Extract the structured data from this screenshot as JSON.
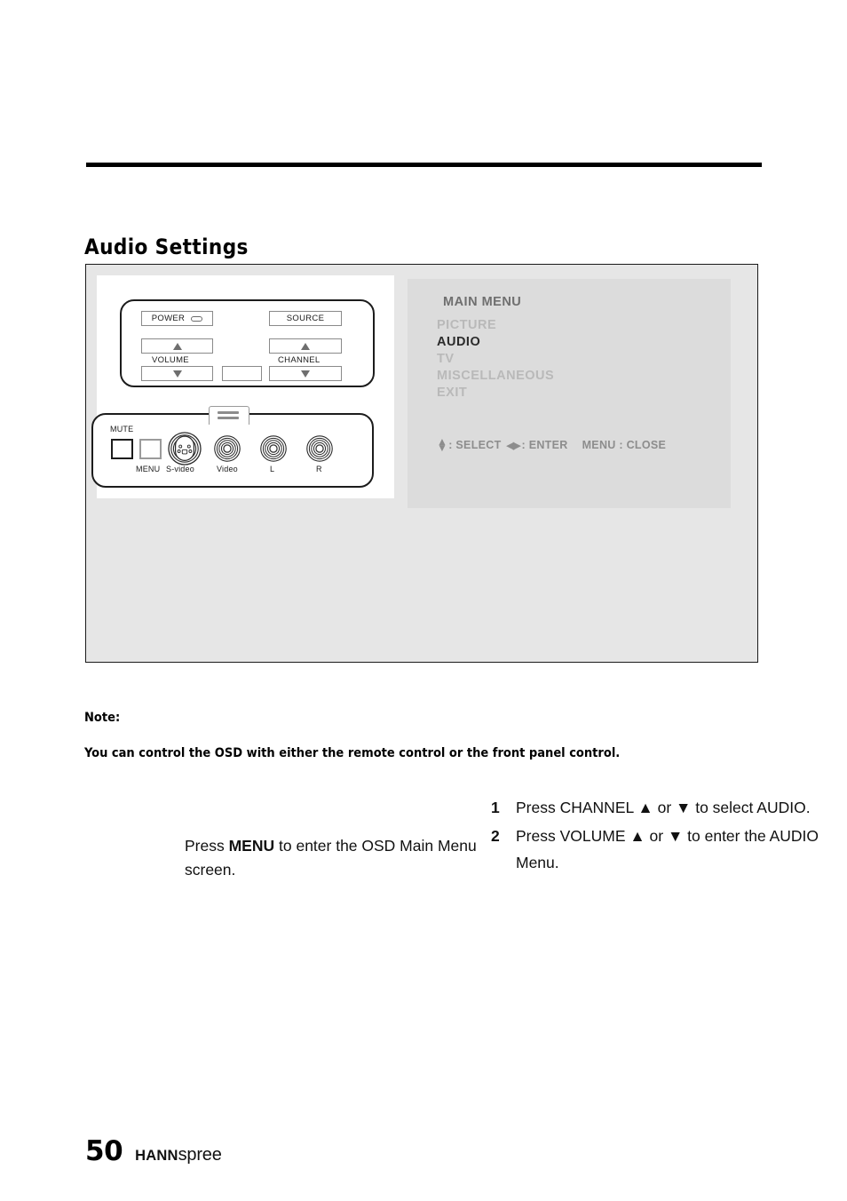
{
  "page": {
    "title": "Audio Settings",
    "number": "50",
    "brand_bold": "HANN",
    "brand_light": "spree"
  },
  "control_panel": {
    "upper": {
      "power_label": "POWER",
      "source_label": "SOURCE",
      "volume_label": "VOLUME",
      "channel_label": "CHANNEL",
      "up_glyph": "△",
      "down_glyph": "▽"
    },
    "lower": {
      "mute_label": "MUTE",
      "menu_label": "MENU",
      "svideo_label": "S-video",
      "video_label": "Video",
      "left_label": "L",
      "right_label": "R"
    }
  },
  "osd": {
    "title": "MAIN MENU",
    "items": [
      {
        "label": "PICTURE",
        "selected": false
      },
      {
        "label": "AUDIO",
        "selected": true
      },
      {
        "label": "TV",
        "selected": false
      },
      {
        "label": "MISCELLANEOUS",
        "selected": false
      },
      {
        "label": "EXIT",
        "selected": false
      }
    ],
    "hint": {
      "select_label": ": SELECT",
      "enter_label": ": ENTER",
      "close_label": "MENU : CLOSE",
      "up_glyph": "▲",
      "down_glyph": "▼",
      "left_glyph": "◀",
      "right_glyph": "▶"
    }
  },
  "instructions": {
    "left": {
      "before": "Press ",
      "bold": "MENU",
      "after": " to enter the OSD Main Menu screen."
    },
    "steps": [
      {
        "num": "1",
        "text": "Press CHANNEL ▲ or ▼ to select AUDIO."
      },
      {
        "num": "2",
        "text": "Press VOLUME ▲ or ▼ to enter the AUDIO Menu."
      }
    ]
  },
  "note": {
    "label": "Note:",
    "body": "You can control the OSD with either the remote control or the front panel control."
  }
}
